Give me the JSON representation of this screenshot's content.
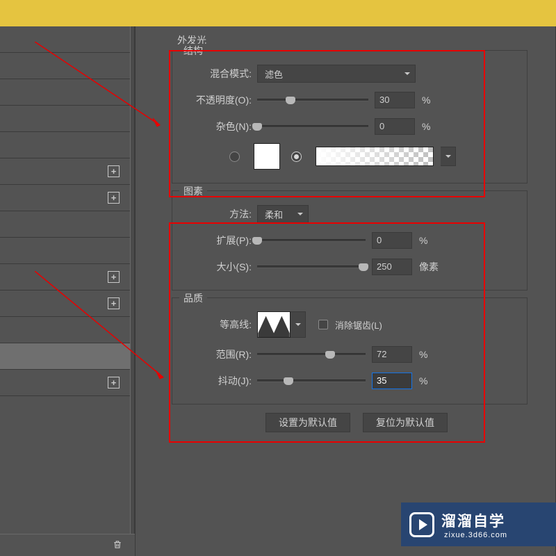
{
  "title": "外发光",
  "structure": {
    "legend": "结构",
    "blend_mode_label": "混合模式:",
    "blend_mode_value": "滤色",
    "opacity_label": "不透明度(O):",
    "opacity_value": "30",
    "opacity_unit": "%",
    "noise_label": "杂色(N):",
    "noise_value": "0",
    "noise_unit": "%",
    "color_solid": "#ffffff"
  },
  "elements": {
    "legend": "图素",
    "technique_label": "方法:",
    "technique_value": "柔和",
    "spread_label": "扩展(P):",
    "spread_value": "0",
    "spread_unit": "%",
    "size_label": "大小(S):",
    "size_value": "250",
    "size_unit": "像素"
  },
  "quality": {
    "legend": "品质",
    "contour_label": "等高线:",
    "antialias_label": "消除锯齿(L)",
    "range_label": "范围(R):",
    "range_value": "72",
    "range_unit": "%",
    "jitter_label": "抖动(J):",
    "jitter_value": "35",
    "jitter_unit": "%"
  },
  "buttons": {
    "set_default": "设置为默认值",
    "reset_default": "复位为默认值"
  },
  "watermark": {
    "cn": "溜溜自学",
    "url": "zixue.3d66.com"
  }
}
